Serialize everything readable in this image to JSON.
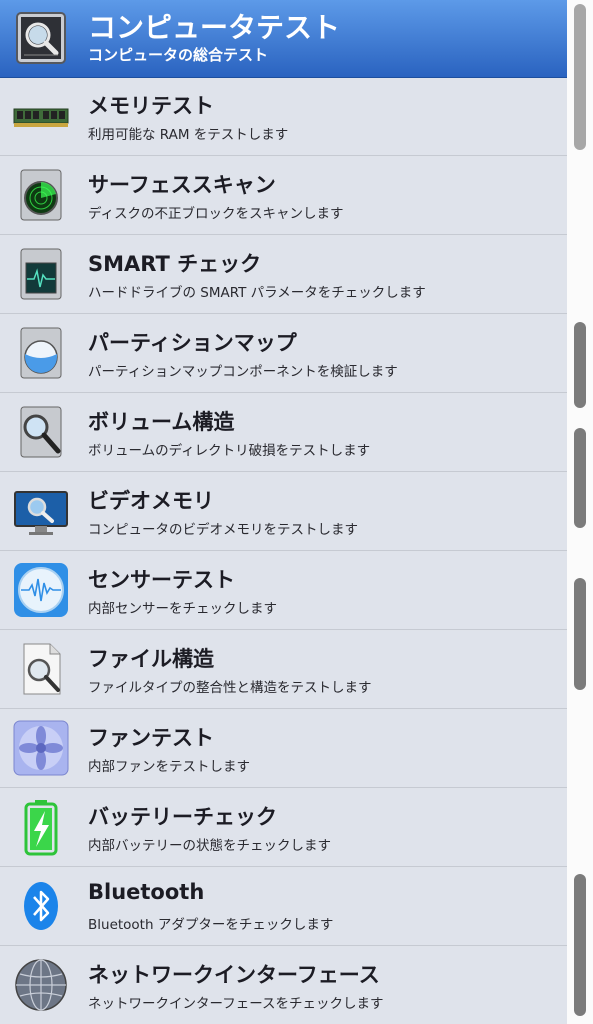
{
  "items": [
    {
      "title": "コンピュータテスト",
      "description": "コンピュータの総合テスト",
      "icon": "computer-icon",
      "selected": true
    },
    {
      "title": "メモリテスト",
      "description": "利用可能な RAM をテストします",
      "icon": "ram-icon"
    },
    {
      "title": "サーフェススキャン",
      "description": "ディスクの不正ブロックをスキャンします",
      "icon": "radar-disk-icon"
    },
    {
      "title": "SMART チェック",
      "description": "ハードドライブの SMART パラメータをチェックします",
      "icon": "heartbeat-disk-icon"
    },
    {
      "title": "パーティションマップ",
      "description": "パーティションマップコンポーネントを検証します",
      "icon": "pie-disk-icon"
    },
    {
      "title": "ボリューム構造",
      "description": "ボリュームのディレクトリ破損をテストします",
      "icon": "magnifier-disk-icon"
    },
    {
      "title": "ビデオメモリ",
      "description": "コンピュータのビデオメモリをテストします",
      "icon": "monitor-magnifier-icon"
    },
    {
      "title": "センサーテスト",
      "description": "内部センサーをチェックします",
      "icon": "sensor-waveform-icon"
    },
    {
      "title": "ファイル構造",
      "description": "ファイルタイプの整合性と構造をテストします",
      "icon": "file-magnifier-icon"
    },
    {
      "title": "ファンテスト",
      "description": "内部ファンをテストします",
      "icon": "fan-icon"
    },
    {
      "title": "バッテリーチェック",
      "description": "内部バッテリーの状態をチェックします",
      "icon": "battery-icon"
    },
    {
      "title": "Bluetooth",
      "description": "Bluetooth アダプターをチェックします",
      "icon": "bluetooth-icon"
    },
    {
      "title": "ネットワークインターフェース",
      "description": "ネットワークインターフェースをチェックします",
      "icon": "network-globe-icon"
    }
  ]
}
